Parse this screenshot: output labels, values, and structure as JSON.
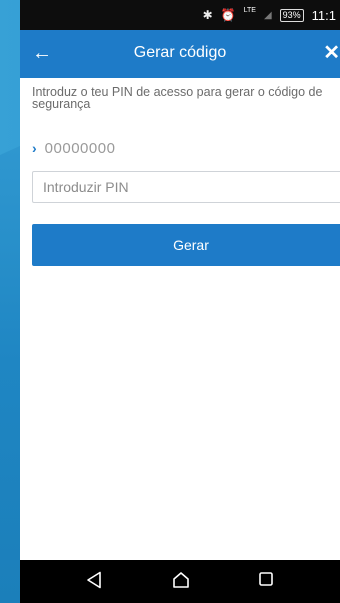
{
  "status_bar": {
    "bluetooth_icon": "bluetooth-icon",
    "alarm_icon": "alarm-icon",
    "network": "LTE",
    "battery": "93%",
    "time": "11:1"
  },
  "app_bar": {
    "title": "Gerar código",
    "back_icon": "arrow-left-icon",
    "close_icon": "close-icon"
  },
  "content": {
    "instructions": "Introduz o teu PIN de acesso para gerar o código de segurança",
    "account_number": "00000000",
    "pin_placeholder": "Introduzir PIN",
    "pin_value": "",
    "button_label": "Gerar"
  },
  "colors": {
    "accent": "#1e7bc8",
    "background": "#2a93cc"
  },
  "nav_bar": {
    "back_icon": "nav-back-triangle-icon",
    "home_icon": "nav-home-icon",
    "recents_icon": "nav-recents-square-icon"
  }
}
